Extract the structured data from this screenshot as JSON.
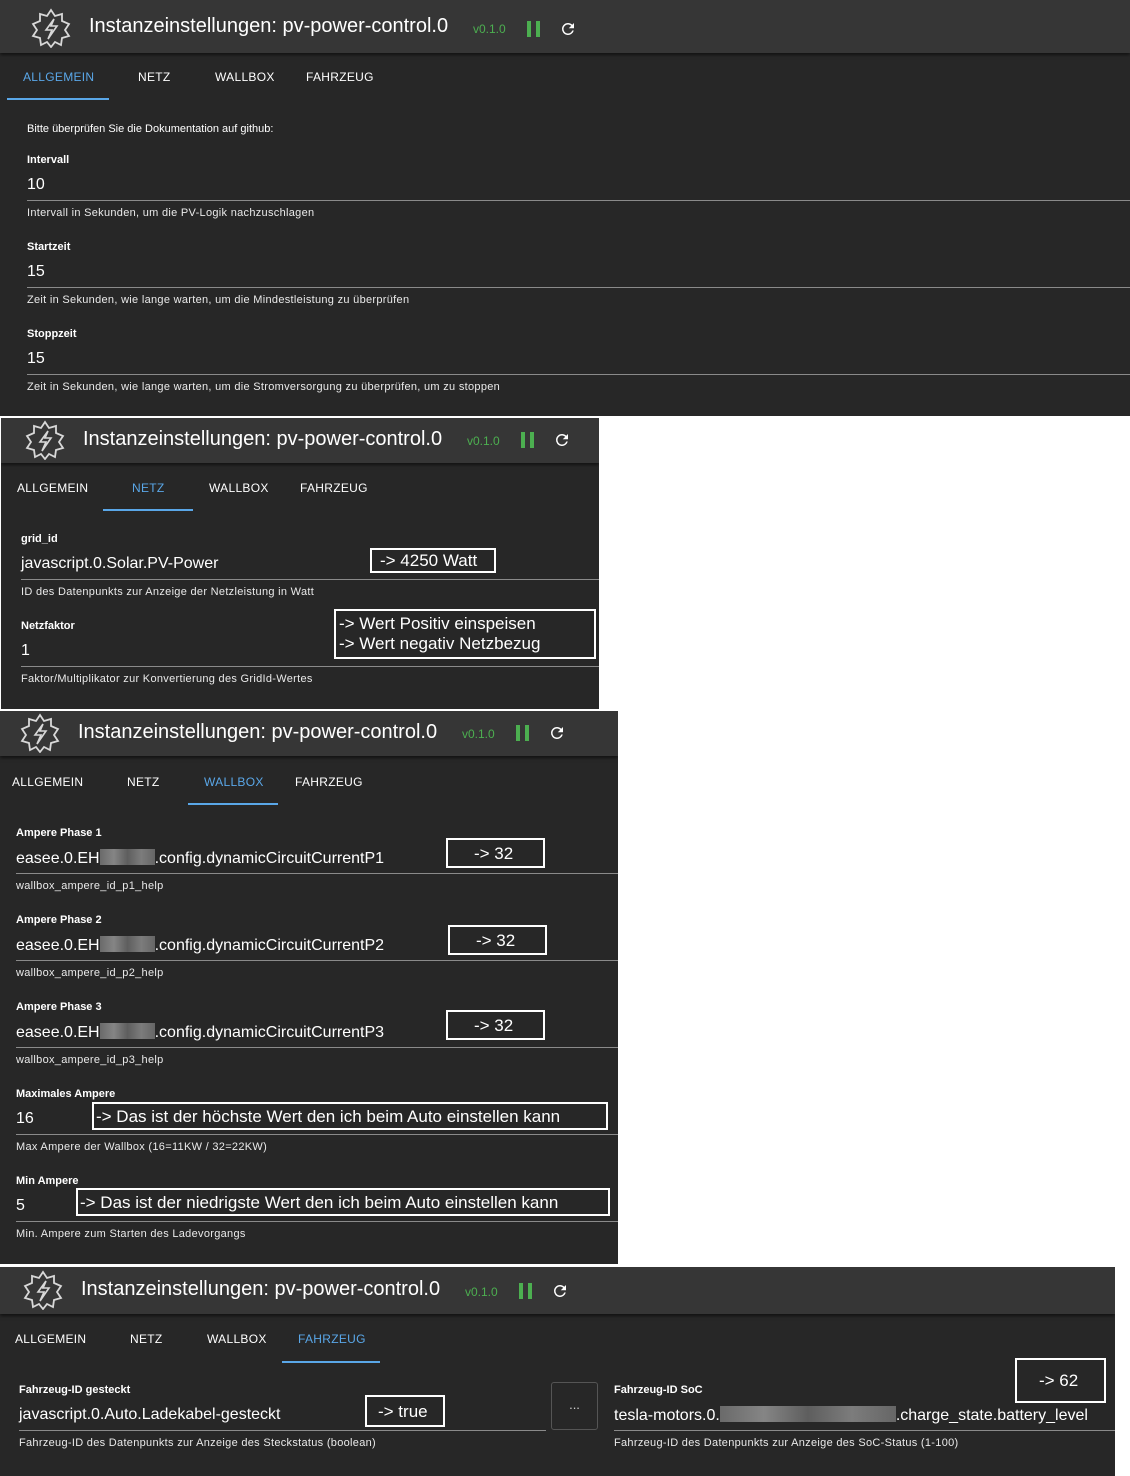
{
  "title": "Instanzeinstellungen: pv-power-control.0",
  "version": "v0.1.0",
  "tabs": [
    "ALLGEMEIN",
    "NETZ",
    "WALLBOX",
    "FAHRZEUG"
  ],
  "allgemein": {
    "note": "Bitte überprüfen Sie die Dokumentation auf github:",
    "intervall": {
      "label": "Intervall",
      "value": "10",
      "help": "Intervall in Sekunden, um die PV-Logik nachzuschlagen"
    },
    "startzeit": {
      "label": "Startzeit",
      "value": "15",
      "help": "Zeit in Sekunden, wie lange warten, um die Mindestleistung zu überprüfen"
    },
    "stoppzeit": {
      "label": "Stoppzeit",
      "value": "15",
      "help": "Zeit in Sekunden, wie lange warten, um die Stromversorgung zu überprüfen, um zu stoppen"
    }
  },
  "netz": {
    "grid_id": {
      "label": "grid_id",
      "value": "javascript.0.Solar.PV-Power",
      "help": "ID des Datenpunkts zur Anzeige der Netzleistung in Watt",
      "annotation": "-> 4250 Watt"
    },
    "netzfaktor": {
      "label": "Netzfaktor",
      "value": "1",
      "help": "Faktor/Multiplikator zur Konvertierung des GridId-Wertes",
      "annotation_1": "-> Wert Positiv einspeisen",
      "annotation_2": "-> Wert negativ Netzbezug"
    }
  },
  "wallbox": {
    "p1": {
      "label": "Ampere Phase 1",
      "value_prefix": "easee.0.EH",
      "value_suffix": ".config.dynamicCircuitCurrentP1",
      "help": "wallbox_ampere_id_p1_help",
      "annotation": "-> 32"
    },
    "p2": {
      "label": "Ampere Phase 2",
      "value_prefix": "easee.0.EH",
      "value_suffix": ".config.dynamicCircuitCurrentP2",
      "help": "wallbox_ampere_id_p2_help",
      "annotation": "-> 32"
    },
    "p3": {
      "label": "Ampere Phase 3",
      "value_prefix": "easee.0.EH",
      "value_suffix": ".config.dynamicCircuitCurrentP3",
      "help": "wallbox_ampere_id_p3_help",
      "annotation": "-> 32"
    },
    "max": {
      "label": "Maximales Ampere",
      "value": "16",
      "help": "Max Ampere der Wallbox (16=11KW / 32=22KW)",
      "annotation": "-> Das ist der höchste Wert den ich beim Auto einstellen kann"
    },
    "min": {
      "label": "Min Ampere",
      "value": "5",
      "help": "Min. Ampere zum Starten des Ladevorgangs",
      "annotation": "-> Das ist der niedrigste Wert den ich beim Auto einstellen kann"
    }
  },
  "fahrzeug": {
    "plugged": {
      "label": "Fahrzeug-ID gesteckt",
      "value": "javascript.0.Auto.Ladekabel-gesteckt",
      "help": "Fahrzeug-ID des Datenpunkts zur Anzeige des Steckstatus (boolean)",
      "annotation": "-> true"
    },
    "select_button": "...",
    "soc": {
      "label": "Fahrzeug-ID SoC",
      "value_prefix": "tesla-motors.0.",
      "value_suffix": ".charge_state.battery_level",
      "help": "Fahrzeug-ID des Datenpunkts zur Anzeige des SoC-Status (1-100)",
      "annotation": "-> 62"
    }
  }
}
